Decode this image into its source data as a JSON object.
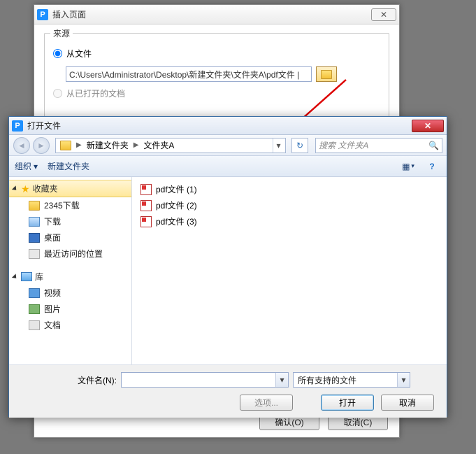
{
  "insert_dialog": {
    "title": "插入页面",
    "close_glyph": "✕",
    "source_legend": "来源",
    "from_file_label": "从文件",
    "file_path": "C:\\Users\\Administrator\\Desktop\\新建文件夹\\文件夹A\\pdf文件 |",
    "from_opened_doc_label": "从已打开的文档",
    "ok_btn": "确认(O)",
    "cancel_btn": "取消(C)"
  },
  "open_dialog": {
    "title": "打开文件",
    "close_glyph": "✕",
    "breadcrumb": {
      "seg1": "新建文件夹",
      "seg2": "文件夹A"
    },
    "search_placeholder": "搜索 文件夹A",
    "toolbar": {
      "organize": "组织",
      "new_folder": "新建文件夹"
    },
    "tree": {
      "favorites": "收藏夹",
      "fav_items": {
        "i0": "2345下载",
        "i1": "下载",
        "i2": "桌面",
        "i3": "最近访问的位置"
      },
      "libraries": "库",
      "lib_items": {
        "i0": "视频",
        "i1": "图片",
        "i2": "文档"
      }
    },
    "files": {
      "f0": "pdf文件 (1)",
      "f1": "pdf文件 (2)",
      "f2": "pdf文件 (3)"
    },
    "filename_label": "文件名(N):",
    "filter_label": "所有支持的文件",
    "options_btn": "选项...",
    "open_btn": "打开",
    "cancel_btn": "取消"
  }
}
